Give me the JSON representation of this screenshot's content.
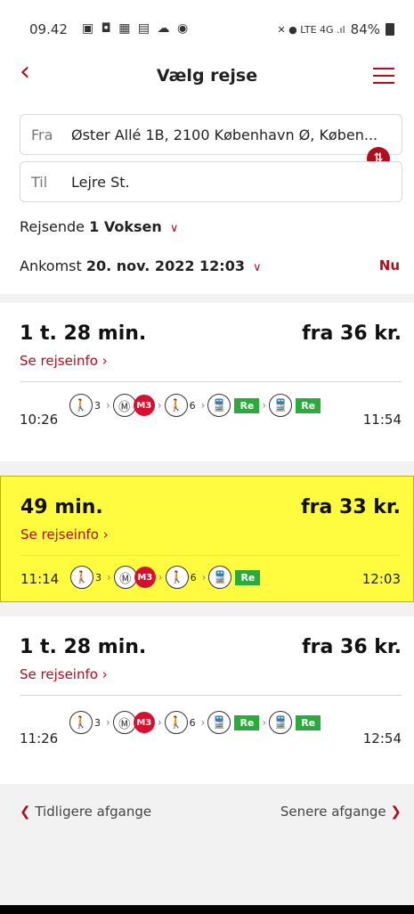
{
  "status_bar": {
    "time": "09.42",
    "app_icons": "▣ ◘ ▦ ▤ ☁ ◉",
    "right_icons": "✕ ● LTE 4G .ıl",
    "battery": "84%"
  },
  "app_bar": {
    "title": "Vælg rejse"
  },
  "search": {
    "from_label": "Fra",
    "from_value": "Øster Allé 1B, 2100 København Ø, Køben...",
    "to_label": "Til",
    "to_value": "Lejre St.",
    "travelers_label": "Rejsende",
    "travelers_value": "1 Voksen",
    "arrival_label": "Ankomst",
    "arrival_value": "20. nov. 2022 12:03",
    "now_label": "Nu"
  },
  "trips": [
    {
      "duration": "1 t. 28 min.",
      "price": "fra 36 kr.",
      "info": "Se rejseinfo ›",
      "depart": "10:26",
      "arrive": "11:54",
      "walk1": "3",
      "metro": "M3",
      "walk2": "6",
      "train": "Re",
      "train2": "Re"
    },
    {
      "duration": "49 min.",
      "price": "fra 33 kr.",
      "info": "Se rejseinfo ›",
      "depart": "11:14",
      "arrive": "12:03",
      "walk1": "3",
      "metro": "M3",
      "walk2": "6",
      "train": "Re"
    },
    {
      "duration": "1 t. 28 min.",
      "price": "fra 36 kr.",
      "info": "Se rejseinfo ›",
      "depart": "11:26",
      "arrive": "12:54",
      "walk1": "3",
      "metro": "M3",
      "walk2": "6",
      "train": "Re",
      "train2": "Re"
    }
  ],
  "pager": {
    "earlier": "Tidligere afgange",
    "later": "Senere afgange"
  },
  "colors": {
    "accent": "#b10d1e",
    "highlight": "#fffc40",
    "metro": "#d8102f",
    "regional": "#2cab3d"
  }
}
